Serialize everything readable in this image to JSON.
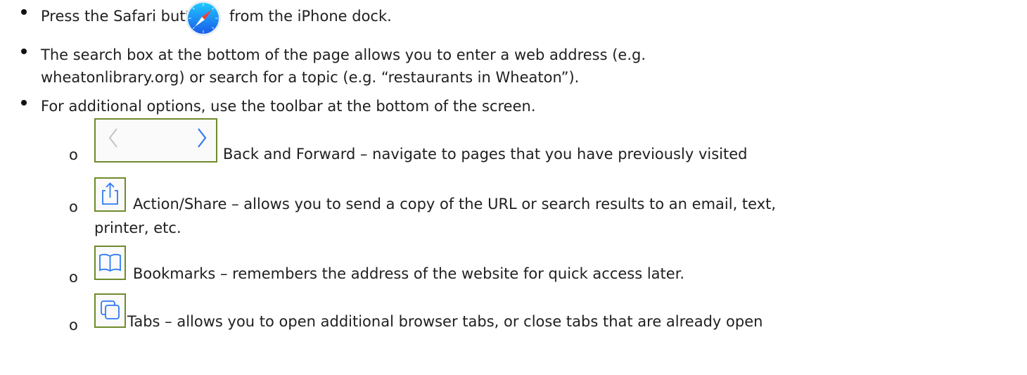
{
  "bullets": [
    {
      "before_icon": "Press the Safari button",
      "icon": "safari-compass-icon",
      "after_icon": "from the iPhone dock."
    },
    {
      "line1": "The search box at the bottom of the page allows you to enter a web address (e.g.",
      "line2": "wheatonlibrary.org) or search for a topic (e.g. “restaurants in Wheaton”)."
    },
    {
      "text": "For additional options, use the toolbar at the bottom of the screen."
    }
  ],
  "sub_marker": "o",
  "toolbar_items": [
    {
      "icon": "back-forward-icon",
      "text": "Back and Forward – navigate to pages that you have previously visited"
    },
    {
      "icon": "share-icon",
      "line1": "Action/Share – allows you to send a copy of the URL or search results to an email, text,",
      "line2": "printer, etc."
    },
    {
      "icon": "bookmarks-icon",
      "text": "Bookmarks – remembers the address of the website for quick access later."
    },
    {
      "icon": "tabs-icon",
      "text": "Tabs – allows you to open additional browser tabs, or close tabs that are already open"
    }
  ],
  "colors": {
    "icon_border": "#6e8b2b",
    "icon_stroke": "#2f7bf6",
    "back_arrow": "#c4c4c4"
  }
}
